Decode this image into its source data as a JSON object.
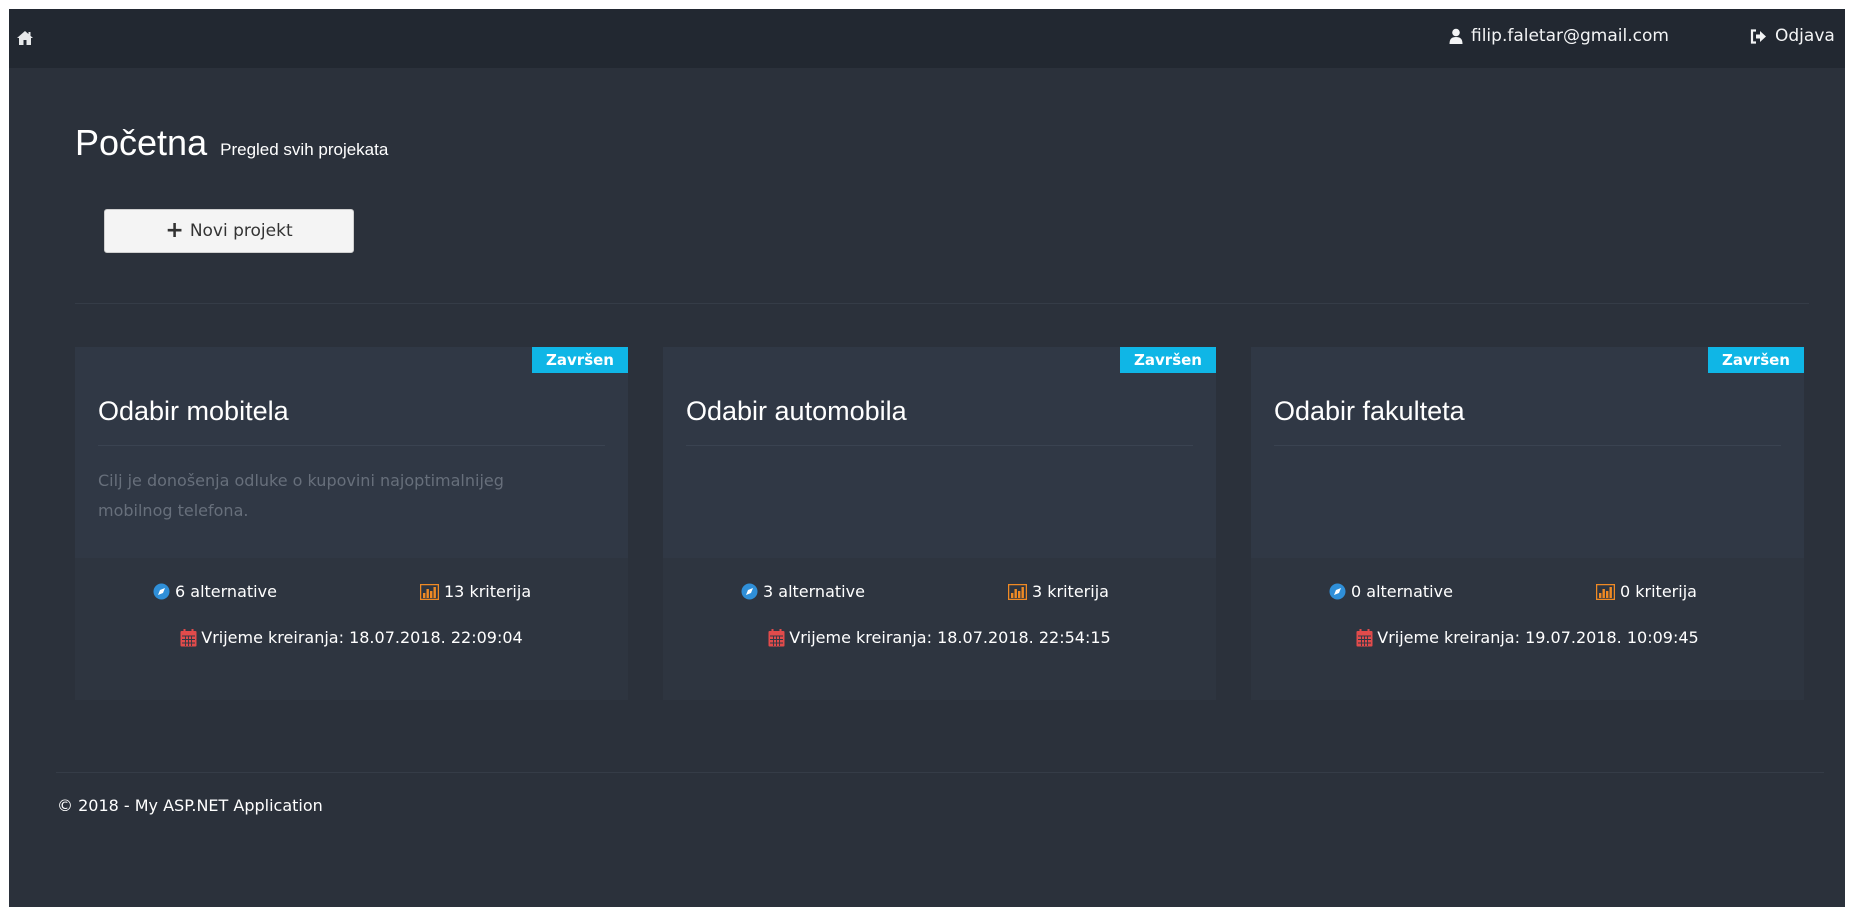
{
  "navbar": {
    "home_icon": "home-icon",
    "user_icon": "user-icon",
    "user_email": "filip.faletar@gmail.com",
    "logout_icon": "logout-icon",
    "logout_label": "Odjava"
  },
  "header": {
    "title": "Početna",
    "subtitle": "Pregled svih projekata"
  },
  "new_project_button": {
    "icon": "plus-icon",
    "label": "Novi projekt"
  },
  "colors": {
    "page_bg": "#2b313b",
    "navbar_bg": "#222831",
    "card_bg": "#303845",
    "badge_bg": "#0fb6e6",
    "alternatives_icon": "#2f8fd8",
    "criteria_icon": "#f08a24",
    "calendar_icon": "#e14b4b"
  },
  "projects": [
    {
      "badge": "Završen",
      "title": "Odabir mobitela",
      "description": "Cilj je donošenja odluke o kupovini najoptimalnijeg mobilnog telefona.",
      "alternatives": "6 alternative",
      "criteria": "13 kriterija",
      "created": "Vrijeme kreiranja: 18.07.2018. 22:09:04"
    },
    {
      "badge": "Završen",
      "title": "Odabir automobila",
      "description": "",
      "alternatives": "3 alternative",
      "criteria": "3 kriterija",
      "created": "Vrijeme kreiranja: 18.07.2018. 22:54:15"
    },
    {
      "badge": "Završen",
      "title": "Odabir fakulteta",
      "description": "",
      "alternatives": "0 alternative",
      "criteria": "0 kriterija",
      "created": "Vrijeme kreiranja: 19.07.2018. 10:09:45"
    }
  ],
  "footer": {
    "text": "© 2018 - My ASP.NET Application"
  }
}
